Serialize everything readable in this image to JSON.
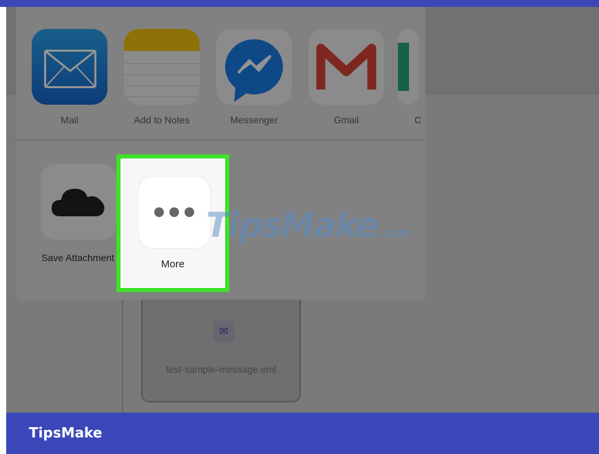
{
  "share_sheet": {
    "apps": [
      {
        "label": "Mail",
        "icon": "mail-icon"
      },
      {
        "label": "Add to Notes",
        "icon": "notes-icon"
      },
      {
        "label": "Messenger",
        "icon": "messenger-icon"
      },
      {
        "label": "Gmail",
        "icon": "gmail-icon"
      },
      {
        "label": "C",
        "icon": "partial-app-icon"
      }
    ],
    "actions": [
      {
        "label": "Save Attachment",
        "icon": "cloud-icon"
      },
      {
        "label": "More",
        "icon": "more-dots-icon"
      }
    ]
  },
  "attachment": {
    "filename": "test-sample-message.eml",
    "icon": "envelope-icon"
  },
  "watermark": {
    "text": "TipsMake",
    "suffix": ".com"
  },
  "caption": {
    "text": "TipsMake"
  },
  "colors": {
    "highlight": "#3fe12a",
    "caption_bar": "#3b47b8",
    "mail_blue": "#1e7ee0",
    "notes_yellow": "#f4c510",
    "messenger_blue": "#1a7de8",
    "gmail_red": "#d9443a"
  }
}
